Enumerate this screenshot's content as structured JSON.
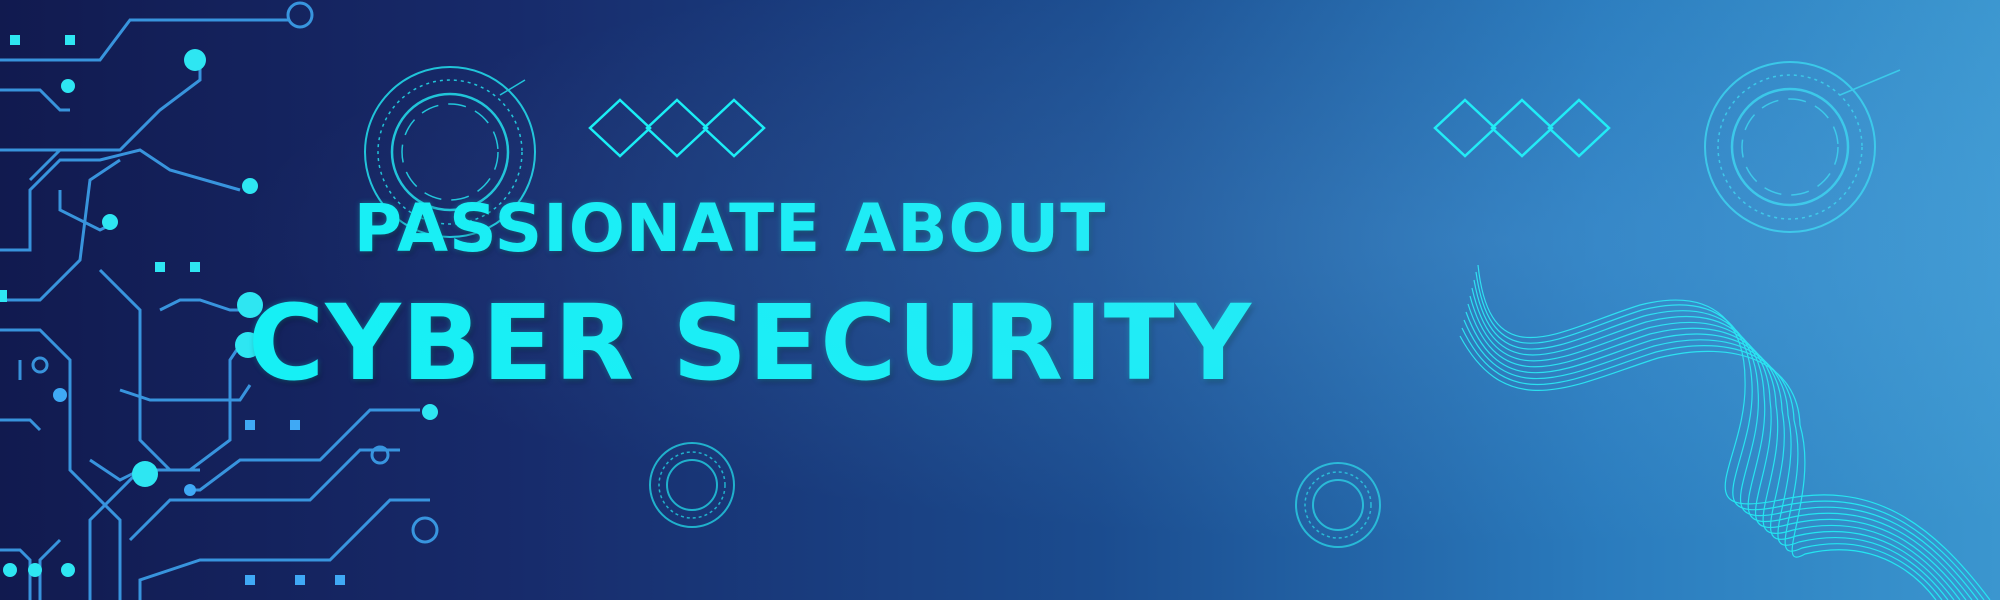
{
  "banner": {
    "headline_line1": "PASSIONATE ABOUT",
    "headline_line2": "CYBER SECURITY"
  },
  "colors": {
    "accent": "#16f0f5",
    "background_dark": "#111a4f",
    "background_light": "#3b96cf"
  },
  "icons": [
    "circuit-board-graphic",
    "hud-circle-icon",
    "diamond-pattern-icon",
    "wave-lines-graphic"
  ]
}
